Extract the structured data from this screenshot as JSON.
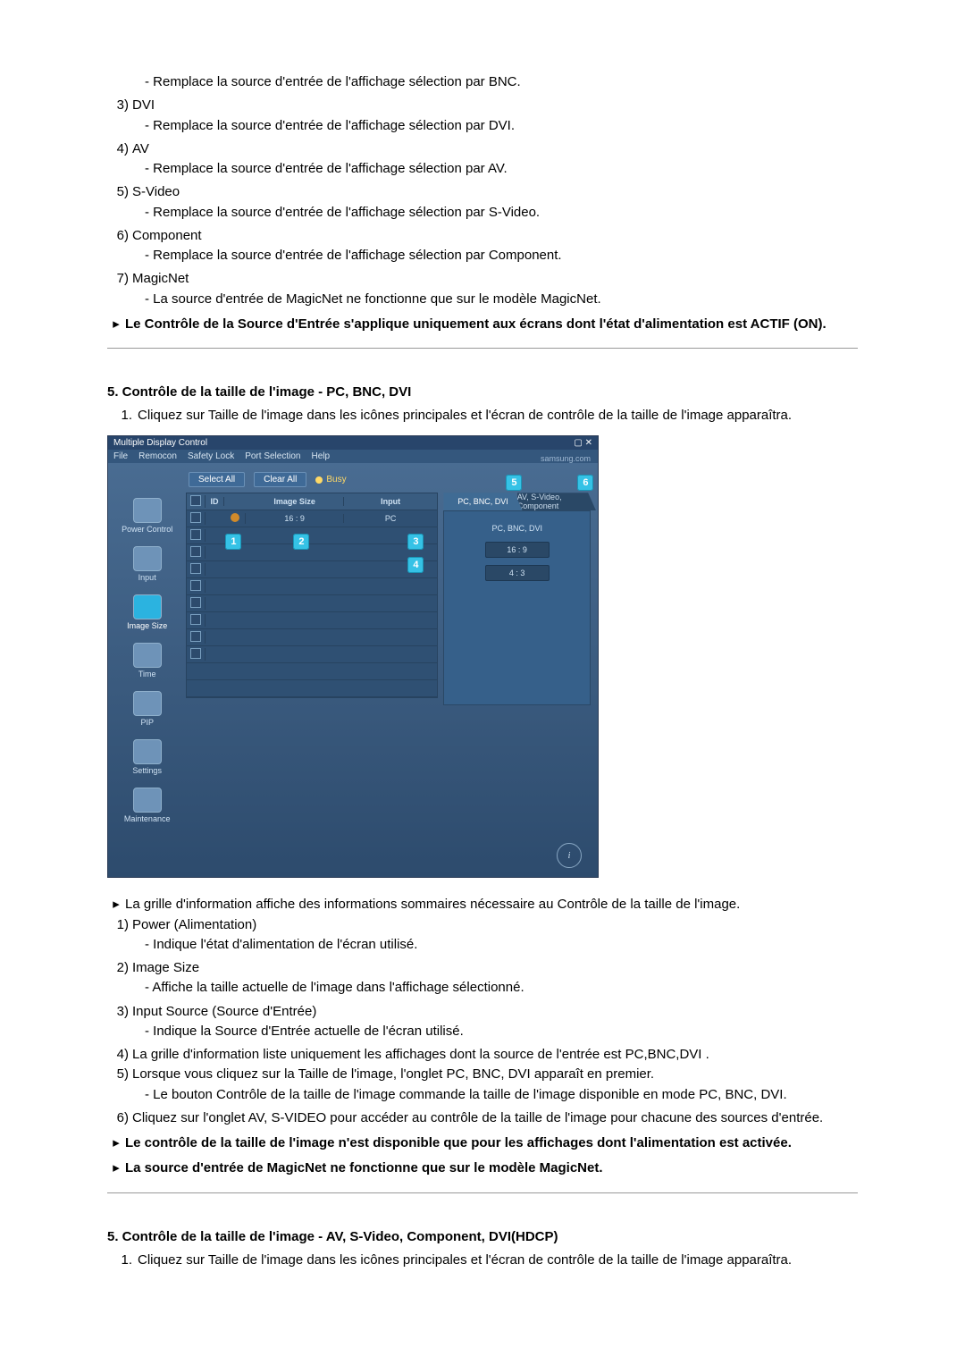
{
  "top_list": [
    {
      "desc": "- Remplace la source d'entrée de l'affichage sélection par BNC."
    },
    {
      "num": "3)",
      "title": "DVI",
      "desc": "- Remplace la source d'entrée de l'affichage sélection par DVI."
    },
    {
      "num": "4)",
      "title": "AV",
      "desc": "- Remplace la source d'entrée de l'affichage sélection par AV."
    },
    {
      "num": "5)",
      "title": "S-Video",
      "desc": "- Remplace la source d'entrée de l'affichage sélection par S-Video."
    },
    {
      "num": "6)",
      "title": "Component",
      "desc": "- Remplace la source d'entrée de l'affichage sélection par Component."
    },
    {
      "num": "7)",
      "title": "MagicNet",
      "desc": "- La source d'entrée de MagicNet ne fonctionne que sur le modèle MagicNet."
    }
  ],
  "top_note": "Le Contrôle de la Source d'Entrée s'applique uniquement aux écrans dont l'état d'alimentation est ACTIF (ON).",
  "section2": {
    "heading": "5. Contrôle de la taille de l'image - PC, BNC, DVI",
    "step1_num": "1.",
    "step1": "Cliquez sur Taille de l'image dans les icônes principales et l'écran de contrôle de la taille de l'image apparaîtra.",
    "info_arrow_text": "La grille d'information affiche des informations sommaires nécessaire au Contrôle de la taille de l'image.",
    "items": [
      {
        "num": "1)",
        "title": "Power (Alimentation)",
        "desc": "- Indique l'état d'alimentation de l'écran utilisé."
      },
      {
        "num": "2)",
        "title": "Image Size",
        "desc": "- Affiche la taille actuelle de l'image dans l'affichage sélectionné."
      },
      {
        "num": "3)",
        "title": "Input Source (Source d'Entrée)",
        "desc": "- Indique la Source d'Entrée actuelle de l'écran utilisé."
      },
      {
        "num": "4)",
        "title": "La grille d'information liste uniquement les affichages dont la source de l'entrée est PC,BNC,DVI ."
      },
      {
        "num": "5)",
        "title": "Lorsque vous cliquez sur la Taille de l'image, l'onglet PC, BNC, DVI apparaît en premier.",
        "desc": "- Le bouton Contrôle de la taille de l'image commande la taille de l'image disponible en mode PC, BNC, DVI."
      },
      {
        "num": "6)",
        "title": "Cliquez sur l'onglet AV, S-VIDEO pour accéder au contrôle de la taille de l'image pour chacune des sources d'entrée."
      }
    ],
    "note1": "Le contrôle de la taille de l'image n'est disponible que pour les affichages dont l'alimentation est activée.",
    "note2": "La source d'entrée de MagicNet ne fonctionne que sur le modèle MagicNet."
  },
  "section3": {
    "heading": "5. Contrôle de la taille de l'image - AV, S-Video, Component, DVI(HDCP)",
    "step1_num": "1.",
    "step1": "Cliquez sur Taille de l'image dans les icônes principales et l'écran de contrôle de la taille de l'image apparaîtra."
  },
  "app": {
    "title": "Multiple Display Control",
    "menus": [
      "File",
      "Remocon",
      "Safety Lock",
      "Port Selection",
      "Help"
    ],
    "brand": "samsung.com",
    "btn_select": "Select All",
    "btn_clear": "Clear All",
    "busy": "Busy",
    "sidebar": [
      "Power Control",
      "Input",
      "Image Size",
      "Time",
      "PIP",
      "Settings",
      "Maintenance"
    ],
    "sidebar_selected": 2,
    "grid_headers": {
      "a": "",
      "b": "ID",
      "c": "",
      "d": "Image Size",
      "e": "Input"
    },
    "grid_row1": {
      "d": "16 : 9",
      "e": "PC"
    },
    "tabs": [
      "PC, BNC, DVI",
      "AV, S-Video, Component"
    ],
    "panel_header": "PC, BNC, DVI",
    "pill1": "16 : 9",
    "pill2": "4 : 3",
    "info_icon": "i",
    "callouts": {
      "1": "1",
      "2": "2",
      "3": "3",
      "4": "4",
      "5": "5",
      "6": "6"
    }
  },
  "arrow_glyph": "▸"
}
